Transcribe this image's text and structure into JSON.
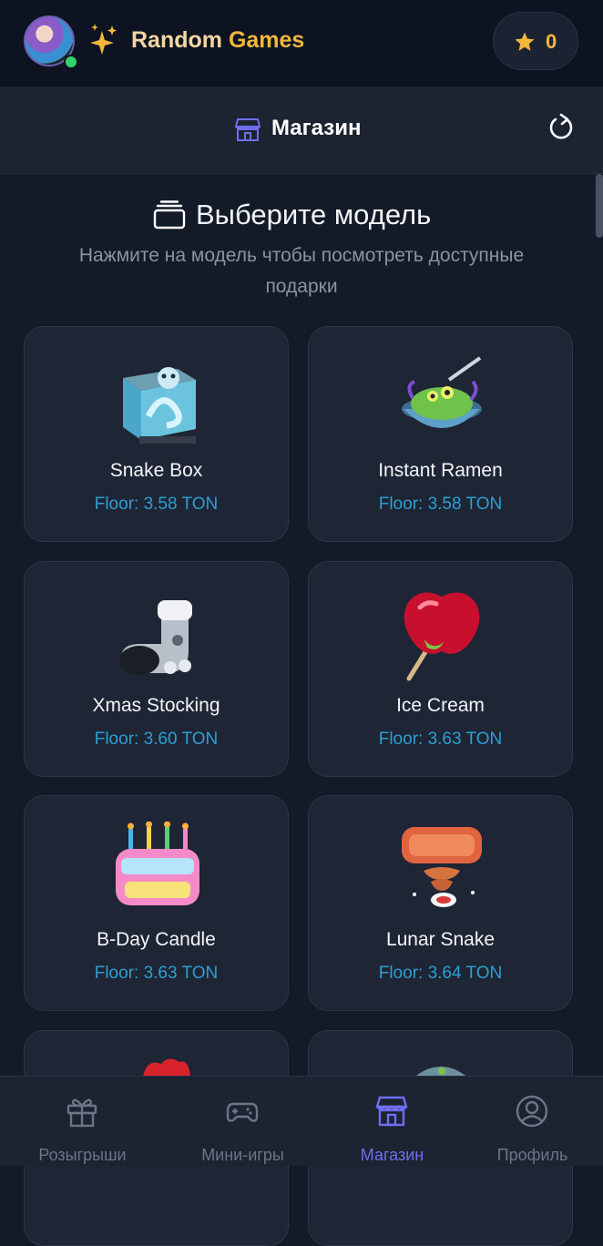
{
  "header": {
    "brand_word1": "Random",
    "brand_word2": "Games",
    "stars_count": "0",
    "avatar_icon": "user-avatar",
    "sparkle_icon": "sparkle-icon",
    "star_icon": "star-icon"
  },
  "shop": {
    "title": "Магазин",
    "shop_icon": "store-icon",
    "refresh_icon": "refresh-icon"
  },
  "section": {
    "title": "Выберите модель",
    "subtitle": "Нажмите на модель чтобы посмотреть доступные подарки",
    "icon": "stack-icon"
  },
  "cards": [
    {
      "name": "Snake Box",
      "floor": "Floor: 3.58 TON",
      "icon": "snake-box-icon"
    },
    {
      "name": "Instant Ramen",
      "floor": "Floor: 3.58 TON",
      "icon": "instant-ramen-icon"
    },
    {
      "name": "Xmas Stocking",
      "floor": "Floor: 3.60 TON",
      "icon": "xmas-stocking-icon"
    },
    {
      "name": "Ice Cream",
      "floor": "Floor: 3.63 TON",
      "icon": "candy-apple-icon"
    },
    {
      "name": "B-Day Candle",
      "floor": "Floor: 3.63 TON",
      "icon": "birthday-cake-icon"
    },
    {
      "name": "Lunar Snake",
      "floor": "Floor: 3.64 TON",
      "icon": "lunar-snake-icon"
    }
  ],
  "nav": [
    {
      "label": "Розыгрыши",
      "icon": "gift-icon",
      "active": false
    },
    {
      "label": "Мини-игры",
      "icon": "gamepad-icon",
      "active": false
    },
    {
      "label": "Магазин",
      "icon": "store-icon",
      "active": true
    },
    {
      "label": "Профиль",
      "icon": "profile-icon",
      "active": false
    }
  ],
  "colors": {
    "accent": "#6f6ef0",
    "brand_gold": "#f4b73a",
    "floor_text": "#2c9fd4",
    "background": "#131a28"
  }
}
